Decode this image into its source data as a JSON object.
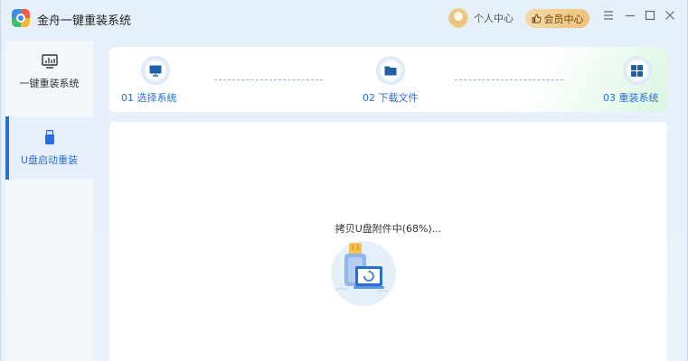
{
  "app": {
    "title": "金舟一键重装系统",
    "logo_icon": "app-logo-icon"
  },
  "header": {
    "user_center": "个人中心",
    "vip_label": "会员中心",
    "menu_icon": "menu-icon",
    "minimize_icon": "minimize-icon",
    "maximize_icon": "maximize-icon",
    "close_icon": "close-icon"
  },
  "sidebar": {
    "items": [
      {
        "label": "一键重装系统",
        "icon": "monitor-chart-icon",
        "active": false
      },
      {
        "label": "U盘启动重装",
        "icon": "usb-drive-icon",
        "active": true
      }
    ]
  },
  "steps": [
    {
      "label": "01 选择系统",
      "icon": "monitor-icon"
    },
    {
      "label": "02 下载文件",
      "icon": "folder-icon"
    },
    {
      "label": "03 重装系统",
      "icon": "windows-icon"
    }
  ],
  "main": {
    "status_text": "拷贝U盘附件中(68%)...",
    "progress_percent": 68,
    "illustration": "usb-copy-illustration"
  },
  "colors": {
    "accent": "#2a6fd6",
    "vip_bg": "#efc27b",
    "sidebar_bg": "#f3f7fc"
  }
}
